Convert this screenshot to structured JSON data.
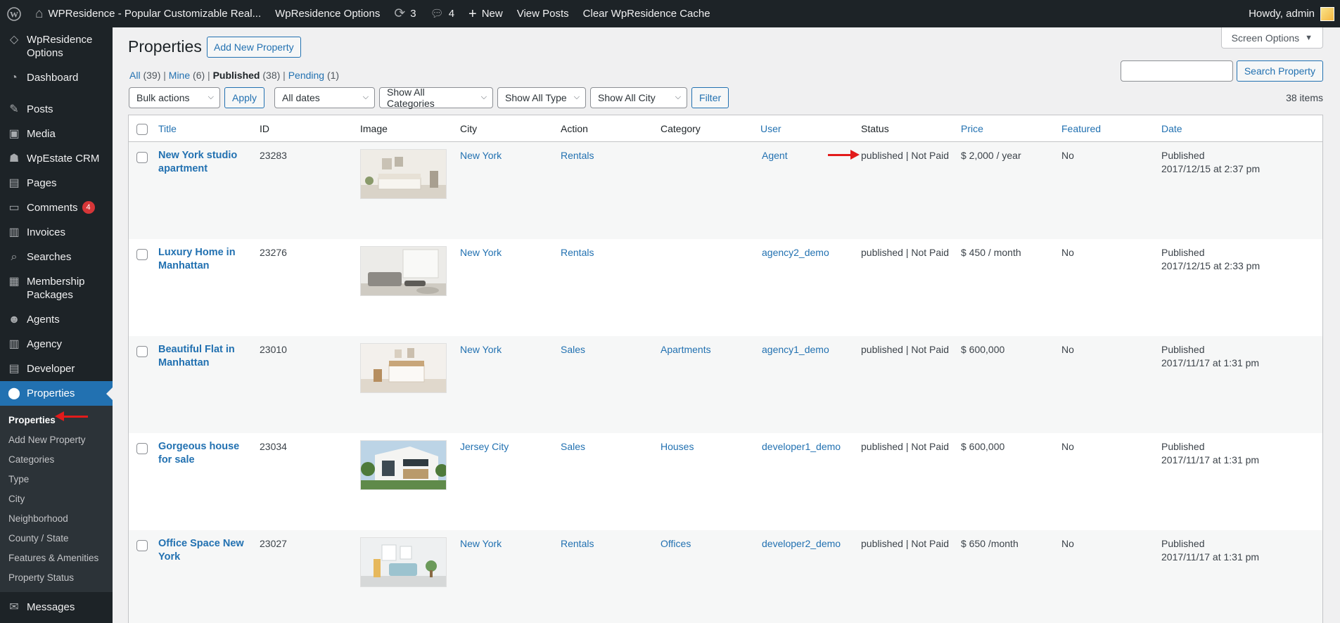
{
  "adminbar": {
    "site_name": "WPResidence - Popular Customizable Real...",
    "options": "WpResidence Options",
    "updates": "3",
    "comments": "4",
    "new": "New",
    "view_posts": "View Posts",
    "clear_cache": "Clear WpResidence Cache",
    "howdy": "Howdy, admin"
  },
  "sidebar": {
    "items": [
      {
        "label": "WpResidence Options",
        "icon": "diamond-icon"
      },
      {
        "label": "Dashboard",
        "icon": "dashboard-icon"
      },
      {
        "label": "Posts",
        "icon": "pin-icon"
      },
      {
        "label": "Media",
        "icon": "media-icon"
      },
      {
        "label": "WpEstate CRM",
        "icon": "crm-icon"
      },
      {
        "label": "Pages",
        "icon": "pages-icon"
      },
      {
        "label": "Comments",
        "icon": "comments-icon",
        "badge": "4"
      },
      {
        "label": "Invoices",
        "icon": "invoice-icon"
      },
      {
        "label": "Searches",
        "icon": "search-icon"
      },
      {
        "label": "Membership Packages",
        "icon": "calendar-icon"
      },
      {
        "label": "Agents",
        "icon": "user-icon"
      },
      {
        "label": "Agency",
        "icon": "building-icon"
      },
      {
        "label": "Developer",
        "icon": "briefcase-icon"
      },
      {
        "label": "Properties",
        "icon": "location-pin-icon"
      }
    ],
    "submenu": [
      "Properties",
      "Add New Property",
      "Categories",
      "Type",
      "City",
      "Neighborhood",
      "County / State",
      "Features & Amenities",
      "Property Status"
    ],
    "messages": "Messages"
  },
  "screen_options": "Screen Options",
  "page_title": "Properties",
  "add_new": "Add New Property",
  "views": {
    "all": "All",
    "all_count": "(39)",
    "mine": "Mine",
    "mine_count": "(6)",
    "published": "Published",
    "published_count": "(38)",
    "pending": "Pending",
    "pending_count": "(1)"
  },
  "search_button": "Search Property",
  "filters": {
    "bulk": "Bulk actions",
    "apply": "Apply",
    "dates": "All dates",
    "categories": "Show All Categories",
    "types": "Show All Type",
    "cities": "Show All City",
    "filter": "Filter"
  },
  "items_count": "38 items",
  "columns": {
    "title": "Title",
    "id": "ID",
    "image": "Image",
    "city": "City",
    "action": "Action",
    "category": "Category",
    "user": "User",
    "status": "Status",
    "price": "Price",
    "featured": "Featured",
    "date": "Date"
  },
  "rows": [
    {
      "title": "New York studio apartment",
      "id": "23283",
      "city": "New York",
      "action": "Rentals",
      "category": "",
      "user": "Agent",
      "status": "published | Not Paid",
      "price": "$ 2,000 / year",
      "featured": "No",
      "date_status": "Published",
      "date": "2017/12/15 at 2:37 pm"
    },
    {
      "title": "Luxury Home in Manhattan",
      "id": "23276",
      "city": "New York",
      "action": "Rentals",
      "category": "",
      "user": "agency2_demo",
      "status": "published | Not Paid",
      "price": "$ 450 / month",
      "featured": "No",
      "date_status": "Published",
      "date": "2017/12/15 at 2:33 pm"
    },
    {
      "title": "Beautiful Flat in Manhattan",
      "id": "23010",
      "city": "New York",
      "action": "Sales",
      "category": "Apartments",
      "user": "agency1_demo",
      "status": "published | Not Paid",
      "price": "$ 600,000",
      "featured": "No",
      "date_status": "Published",
      "date": "2017/11/17 at 1:31 pm"
    },
    {
      "title": "Gorgeous house for sale",
      "id": "23034",
      "city": "Jersey City",
      "action": "Sales",
      "category": "Houses",
      "user": "developer1_demo",
      "status": "published | Not Paid",
      "price": "$ 600,000",
      "featured": "No",
      "date_status": "Published",
      "date": "2017/11/17 at 1:31 pm"
    },
    {
      "title": "Office Space New York",
      "id": "23027",
      "city": "New York",
      "action": "Rentals",
      "category": "Offices",
      "user": "developer2_demo",
      "status": "published | Not Paid",
      "price": "$ 650 /month",
      "featured": "No",
      "date_status": "Published",
      "date": "2017/11/17 at 1:31 pm"
    }
  ],
  "colors": {
    "accent": "#2271b1",
    "adminbar": "#1d2327",
    "annotation_arrow": "#e21b1b"
  }
}
